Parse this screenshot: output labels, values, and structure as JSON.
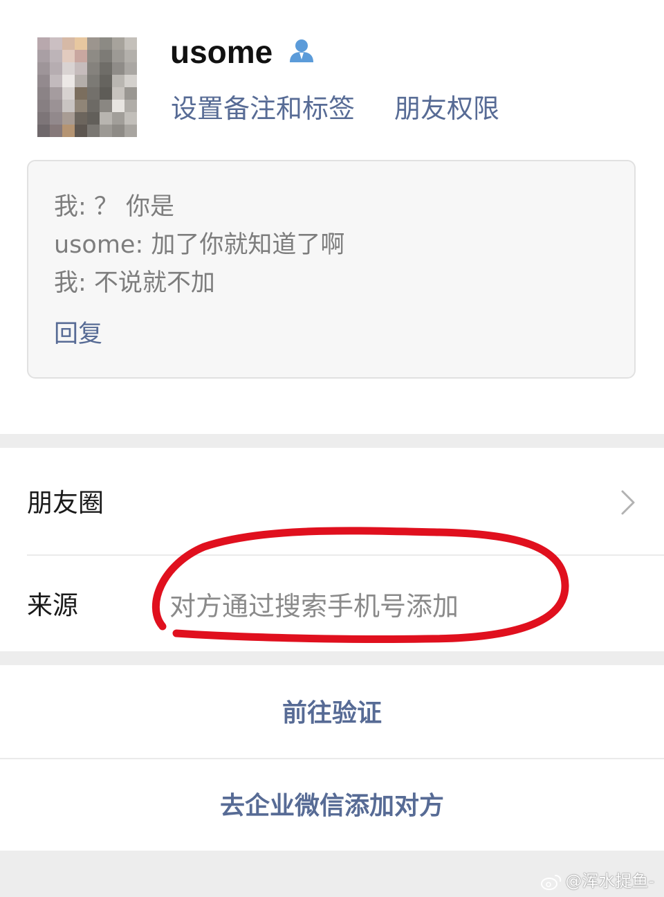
{
  "profile": {
    "name": "usome",
    "avatar_icon": "blurred-avatar",
    "verified_icon": "person-icon",
    "remark_link": "设置备注和标签",
    "permission_link": "朋友权限"
  },
  "message_card": {
    "lines": [
      "我: ？ 你是",
      "usome: 加了你就知道了啊",
      "我: 不说就不加"
    ],
    "reply_label": "回复"
  },
  "moments": {
    "label": "朋友圈",
    "icon": "chevron-right-icon"
  },
  "source": {
    "label": "来源",
    "value": "对方通过搜索手机号添加",
    "annotation_color": "#e0101e"
  },
  "actions": {
    "verify": "前往验证",
    "wecom_add": "去企业微信添加对方"
  },
  "watermark": {
    "text": "@浑水捉鱼-",
    "icon": "weibo-icon"
  },
  "colors": {
    "link": "#576b95",
    "card_bg": "#f7f7f7",
    "band_bg": "#ededed"
  }
}
